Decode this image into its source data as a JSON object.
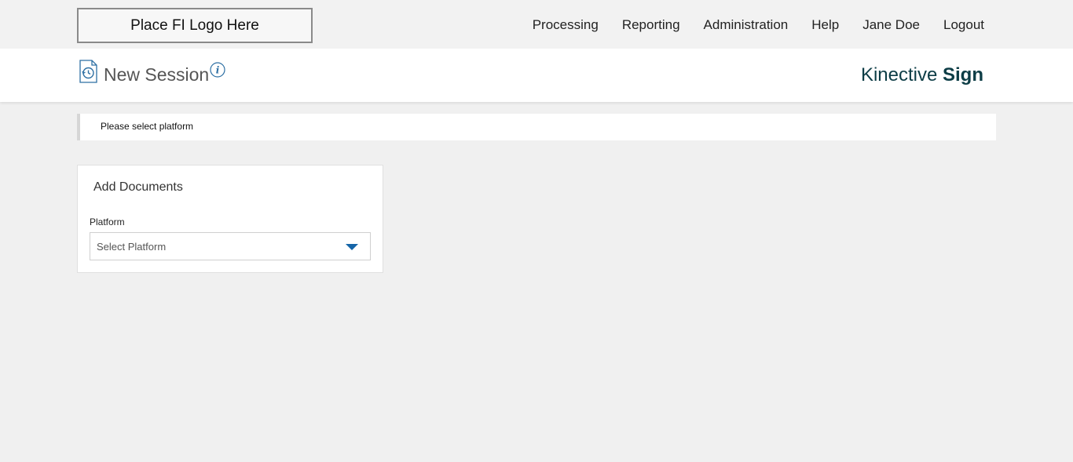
{
  "topbar": {
    "logo_text": "Place FI Logo Here",
    "nav": [
      {
        "label": "Processing"
      },
      {
        "label": "Reporting"
      },
      {
        "label": "Administration"
      },
      {
        "label": "Help"
      },
      {
        "label": "Jane Doe"
      },
      {
        "label": "Logout"
      }
    ]
  },
  "header": {
    "title": "New Session",
    "session_icon": "document-history-icon",
    "info_icon": "info-icon",
    "brand_part1": "Kinective",
    "brand_part2": "Sign",
    "brand_color": "#0d3d46",
    "icon_color": "#2d6fa3"
  },
  "alert": {
    "message": "Please select platform"
  },
  "card": {
    "title": "Add Documents",
    "platform_label": "Platform",
    "platform_placeholder": "Select Platform",
    "caret_icon": "chevron-down-icon",
    "caret_color": "#1565a8"
  }
}
